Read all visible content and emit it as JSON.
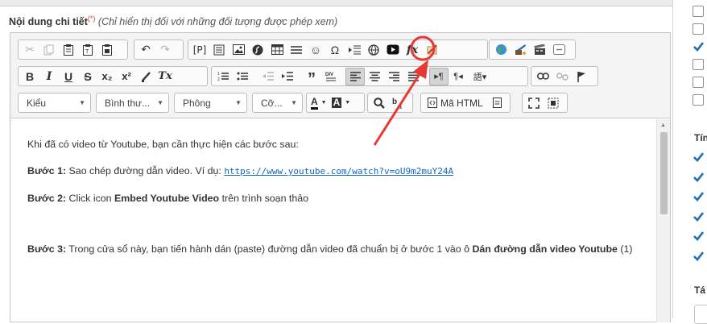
{
  "field": {
    "label": "Nội dung chi tiết",
    "required_mark": "(*)",
    "note": "(Chỉ hiển thị đối với những đối tượng được phép xem)"
  },
  "toolbar": {
    "row1": {
      "group1": [
        "cut-icon",
        "copy-icon",
        "paste-icon",
        "paste-text-icon",
        "paste-word-icon"
      ],
      "group2": [
        "undo-icon",
        "redo-icon"
      ],
      "group3": [
        "placeholder-icon",
        "template-icon",
        "image-icon",
        "flash-icon",
        "table-icon",
        "horizontal-rule-icon",
        "smiley-icon",
        "special-char-icon",
        "page-break-icon",
        "iframe-icon",
        "youtube-icon",
        "formula-icon",
        "paint-icon"
      ],
      "group4": [
        "link-globe-icon",
        "spell-icon",
        "video-icon",
        "div-icon"
      ],
      "placeholder_glyph": "[P]",
      "formula_glyph": "fx",
      "omega_glyph": "Ω"
    },
    "row2": {
      "bold": "B",
      "italic": "I",
      "underline": "U",
      "strike": "S",
      "subscript": "x₂",
      "superscript": "x²",
      "remove_format": "Tx"
    },
    "row3": {
      "style_label": "Kiểu",
      "format_label": "Bình thư...",
      "font_label": "Phông",
      "size_label": "Cỡ...",
      "text_color_label": "A",
      "bg_color_label": "A",
      "source_label": "Mã HTML"
    }
  },
  "content": {
    "intro": "Khi đã có video từ Youtube, bạn cần thực hiện các bước sau:",
    "step1_label": "Bước 1:",
    "step1_text": " Sao chép đường dẫn video. Ví dụ: ",
    "step1_url": "https://www.youtube.com/watch?v=oU9m2muY24A",
    "step2_label": "Bước 2:",
    "step2_text": " Click icon ",
    "step2_bold": "Embed Youtube Video",
    "step2_tail": " trên trình soạn thảo",
    "step3_label": "Bước 3:",
    "step3_text": " Trong cửa sổ này, bạn tiến hành dán (paste) đường dẫn video đã chuẩn bị ở bước 1 vào ô ",
    "step3_bold": "Dán đường dẫn video Youtube",
    "step3_tail": " (1)"
  },
  "right_panel": {
    "heading1": "Tín",
    "heading2": "Tá",
    "top_checkboxes": [
      false,
      false,
      true,
      false,
      false,
      false
    ],
    "bottom_checkboxes": [
      true,
      true,
      true,
      true,
      true,
      true
    ]
  },
  "colors": {
    "annotation_red": "#e53935",
    "link_blue": "#1565c0",
    "check_blue": "#1e6fb8"
  }
}
